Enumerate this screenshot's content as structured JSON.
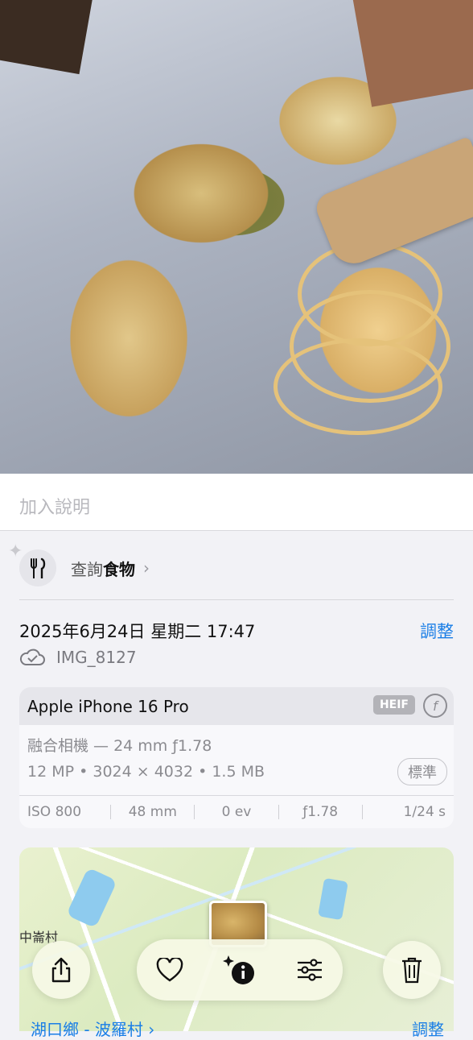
{
  "caption": {
    "placeholder": "加入說明"
  },
  "lookup": {
    "prefix": "查詢",
    "subject": "食物",
    "chevron": "›",
    "icon": "fork-knife-icon"
  },
  "meta": {
    "datetime": "2025年6月24日 星期二 17:47",
    "adjust_label": "調整",
    "filename": "IMG_8127"
  },
  "camera": {
    "device": "Apple iPhone 16 Pro",
    "format_badge": "HEIF",
    "lens": "融合相機 — 24 mm ƒ1.78",
    "specs": "12 MP • 3024 × 4032 • 1.5 MB",
    "style_badge": "標準",
    "exif": {
      "iso": "ISO 800",
      "focal": "48 mm",
      "ev": "0 ev",
      "aperture": "ƒ1.78",
      "shutter": "1/24 s"
    }
  },
  "map": {
    "label": "中崙村"
  },
  "location": {
    "name": "湖口鄉 - 波羅村",
    "chevron": "›",
    "adjust_label": "調整"
  },
  "colors": {
    "accent": "#1a7ee6"
  }
}
